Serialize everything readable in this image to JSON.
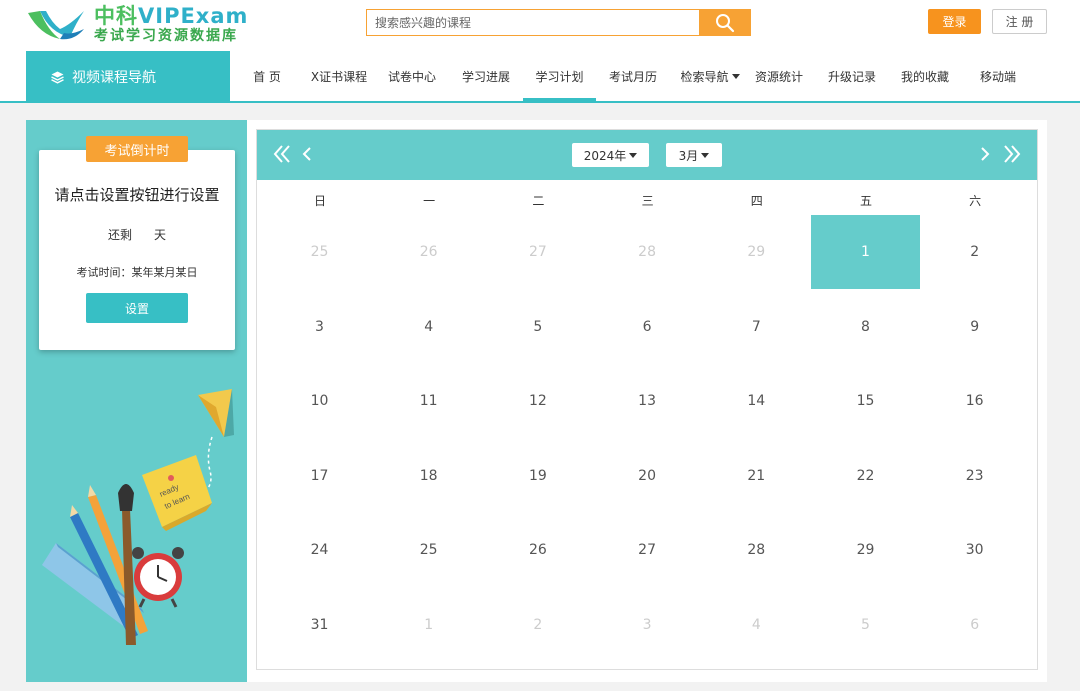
{
  "header": {
    "logo_title_cn": "中科",
    "logo_title_en": "VIPExam",
    "logo_subtitle": "考试学习资源数据库",
    "search_placeholder": "搜索感兴趣的课程",
    "login_label": "登录",
    "register_label": "注 册"
  },
  "nav": {
    "side_label": "视频课程导航",
    "items": [
      {
        "label": "首 页"
      },
      {
        "label": "X证书课程"
      },
      {
        "label": "试卷中心"
      },
      {
        "label": "学习进展"
      },
      {
        "label": "学习计划"
      },
      {
        "label": "考试月历"
      },
      {
        "label": "检索导航"
      },
      {
        "label": "资源统计"
      },
      {
        "label": "升级记录"
      },
      {
        "label": "我的收藏"
      },
      {
        "label": "移动端"
      }
    ],
    "active_index": 4
  },
  "countdown": {
    "tag": "考试倒计时",
    "title": "请点击设置按钮进行设置",
    "remain_prefix": "还剩",
    "remain_suffix": "天",
    "exam_time": "考试时间：某年某月某日",
    "set_button": "设置"
  },
  "illustration": {
    "note_text_1": "ready",
    "note_text_2": "to learn"
  },
  "calendar": {
    "year_label": "2024年",
    "month_label": "3月",
    "weekdays": [
      "日",
      "一",
      "二",
      "三",
      "四",
      "五",
      "六"
    ],
    "weeks": [
      [
        {
          "d": "25",
          "o": true
        },
        {
          "d": "26",
          "o": true
        },
        {
          "d": "27",
          "o": true
        },
        {
          "d": "28",
          "o": true
        },
        {
          "d": "29",
          "o": true
        },
        {
          "d": "1",
          "s": true
        },
        {
          "d": "2"
        }
      ],
      [
        {
          "d": "3"
        },
        {
          "d": "4"
        },
        {
          "d": "5"
        },
        {
          "d": "6"
        },
        {
          "d": "7"
        },
        {
          "d": "8"
        },
        {
          "d": "9"
        }
      ],
      [
        {
          "d": "10"
        },
        {
          "d": "11"
        },
        {
          "d": "12"
        },
        {
          "d": "13"
        },
        {
          "d": "14"
        },
        {
          "d": "15"
        },
        {
          "d": "16"
        }
      ],
      [
        {
          "d": "17"
        },
        {
          "d": "18"
        },
        {
          "d": "19"
        },
        {
          "d": "20"
        },
        {
          "d": "21"
        },
        {
          "d": "22"
        },
        {
          "d": "23"
        }
      ],
      [
        {
          "d": "24"
        },
        {
          "d": "25"
        },
        {
          "d": "26"
        },
        {
          "d": "27"
        },
        {
          "d": "28"
        },
        {
          "d": "29"
        },
        {
          "d": "30"
        }
      ],
      [
        {
          "d": "31"
        },
        {
          "d": "1",
          "o": true
        },
        {
          "d": "2",
          "o": true
        },
        {
          "d": "3",
          "o": true
        },
        {
          "d": "4",
          "o": true
        },
        {
          "d": "5",
          "o": true
        },
        {
          "d": "6",
          "o": true
        }
      ]
    ]
  },
  "colors": {
    "accent_teal": "#37bfc5",
    "calendar_teal": "#65cccb",
    "accent_orange": "#f7a234"
  }
}
